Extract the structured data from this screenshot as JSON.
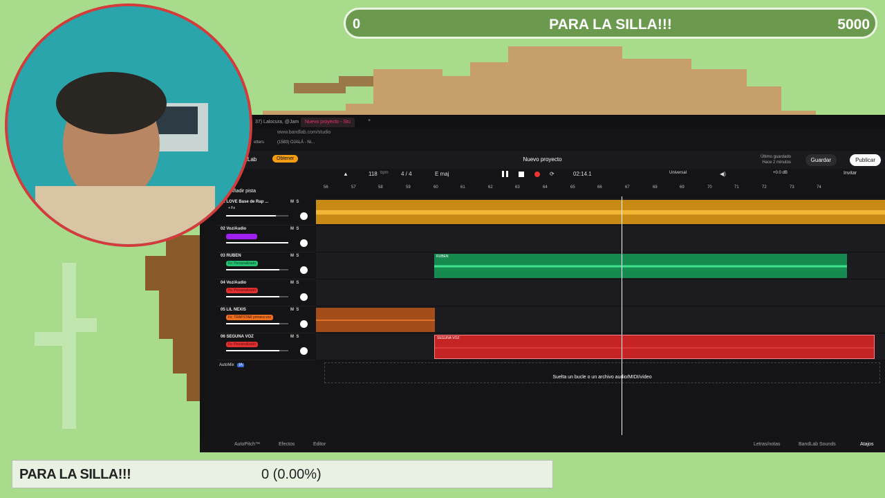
{
  "goal": {
    "left": "0",
    "title": "PARA LA SILLA!!!",
    "right": "5000"
  },
  "bottom_bar": {
    "title": "PARA LA SILLA!!!",
    "value": "0 (0.00%)"
  },
  "browser": {
    "tabs": [
      "37) Lalocura, @Jam",
      "Nuevo proyecto - Stu"
    ],
    "url": "www.bandlab.com/studio",
    "bookmarks": [
      "etters",
      "(1583) OJALÁ - Ni..."
    ]
  },
  "app": {
    "brand": "ndLab",
    "obtener_label": "Obtener",
    "project_title": "Nuevo proyecto",
    "saved_label": "Último guardado",
    "saved_time": "Hace 2 minutos",
    "guardar_label": "Guardar",
    "publicar_label": "Publicar",
    "invitar_label": "Invitar"
  },
  "transport": {
    "bpm": "118",
    "bpm_unit": "bpm",
    "time_sig": "4 / 4",
    "key": "E maj",
    "time": "02:14.1",
    "preset": "Universal",
    "db": "+0.0 dB"
  },
  "tracks_label": "Añadir pista",
  "ruler": [
    "56",
    "57",
    "58",
    "59",
    "60",
    "61",
    "62",
    "63",
    "64",
    "65",
    "66",
    "67",
    "68",
    "69",
    "70",
    "71",
    "72",
    "73",
    "74"
  ],
  "tracks": [
    {
      "name": "01 LOVE Base de Rap ...",
      "fx": "+ Fx",
      "fx_color": "#f0a020",
      "clip_label": "",
      "color": "#f5a623"
    },
    {
      "name": "02 Voz/Audio",
      "fx": "Fx: Vocal Booster",
      "fx_color": "#a020f0",
      "clip_label": "",
      "color": "#a020f0"
    },
    {
      "name": "03 RUBEN",
      "fx": "Fx: Personalizado",
      "fx_color": "#22c070",
      "clip_label": "RUBEN",
      "color": "#1fa660"
    },
    {
      "name": "04 Voz/Audio",
      "fx": "Fx: Personalizado",
      "fx_color": "#e03030",
      "clip_label": "",
      "color": "#e03030"
    },
    {
      "name": "05 LIL NEXIS",
      "fx": "Fx: TRAPSTAR primera voz",
      "fx_color": "#f07020",
      "clip_label": "",
      "color": "#d4682a"
    },
    {
      "name": "06 SEGUNA VOZ",
      "fx": "Fx: Personalizado",
      "fx_color": "#e03030",
      "clip_label": "SEGUNA VOZ",
      "color": "#d02b2b"
    }
  ],
  "automix_label": "AutoMix",
  "automix_badge": "IA",
  "m_label": "M",
  "s_label": "S",
  "dropzone_text": "Suelta un bucle o un archivo audio/MIDI/vídeo",
  "bottom_tools": {
    "autopitch": "AutoPitch™",
    "efectos": "Efectos",
    "editor": "Editor",
    "letras": "Letras/notas",
    "sounds": "BandLab Sounds",
    "atajos": "Atajos"
  }
}
